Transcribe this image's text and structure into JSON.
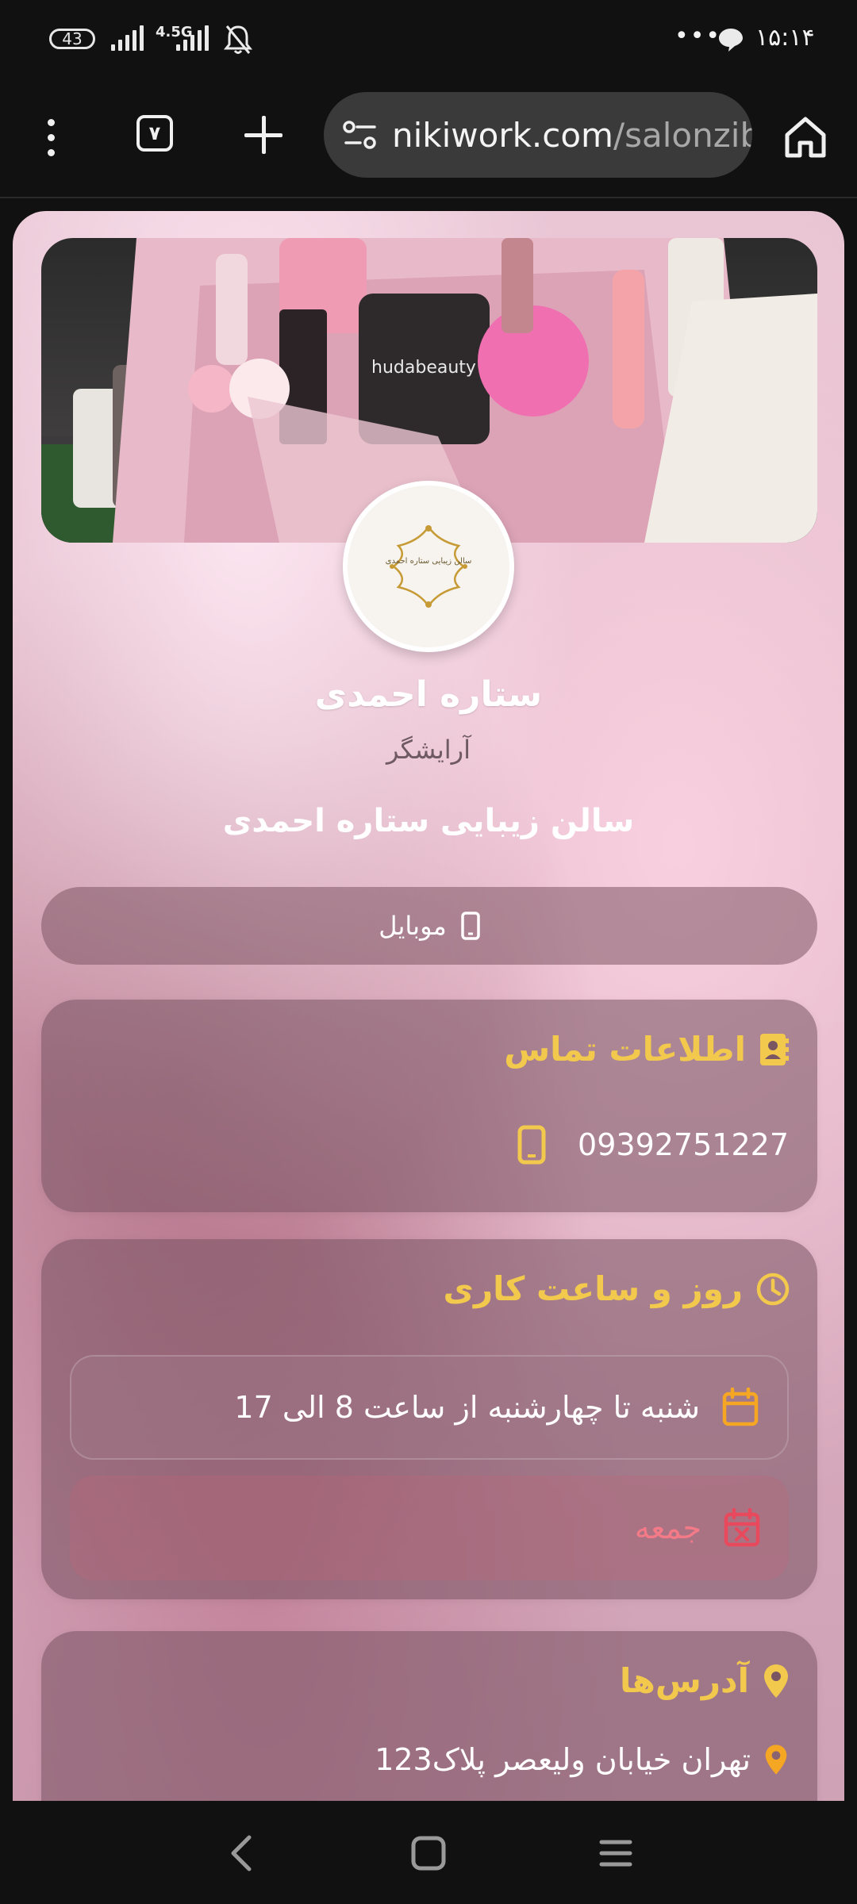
{
  "status_bar": {
    "battery": "43",
    "network": "4.5G",
    "more_indicator": "•••",
    "time": "۱۵:۱۴",
    "icons": [
      "signal-icon",
      "mute-bell-icon",
      "chat-bubble-icon"
    ]
  },
  "browser": {
    "tab_count": "۷",
    "url_domain": "nikiwork.com",
    "url_path": "/salonzib",
    "icons": [
      "menu-dots-icon",
      "new-tab-icon",
      "site-settings-icon",
      "home-icon"
    ]
  },
  "profile": {
    "logo_text": "سالن زیبایی ستاره احمدی",
    "name": "ستاره احمدی",
    "job": "آرایشگر",
    "business": "سالن زیبایی ستاره احمدی"
  },
  "mobile_button": {
    "label": "موبایل",
    "icon": "mobile-phone-icon"
  },
  "contact": {
    "title": "اطلاعات تماس",
    "phone": "09392751227",
    "icons": [
      "contact-book-icon",
      "mobile-phone-icon"
    ]
  },
  "hours": {
    "title": "روز و ساعت کاری",
    "weekday": "شنبه تا چهارشنبه از ساعت 8 الی 17",
    "closed": "جمعه",
    "icons": [
      "clock-icon",
      "calendar-icon",
      "calendar-closed-icon"
    ]
  },
  "address": {
    "title": "آدرس‌ها",
    "line": "تهران خیابان ولیعصر پلاک123",
    "icons": [
      "location-pin-icon"
    ]
  },
  "colors": {
    "accent_gold": "#f2c94c",
    "closed_red": "#f47a88",
    "calendar_orange": "#f5a623"
  }
}
